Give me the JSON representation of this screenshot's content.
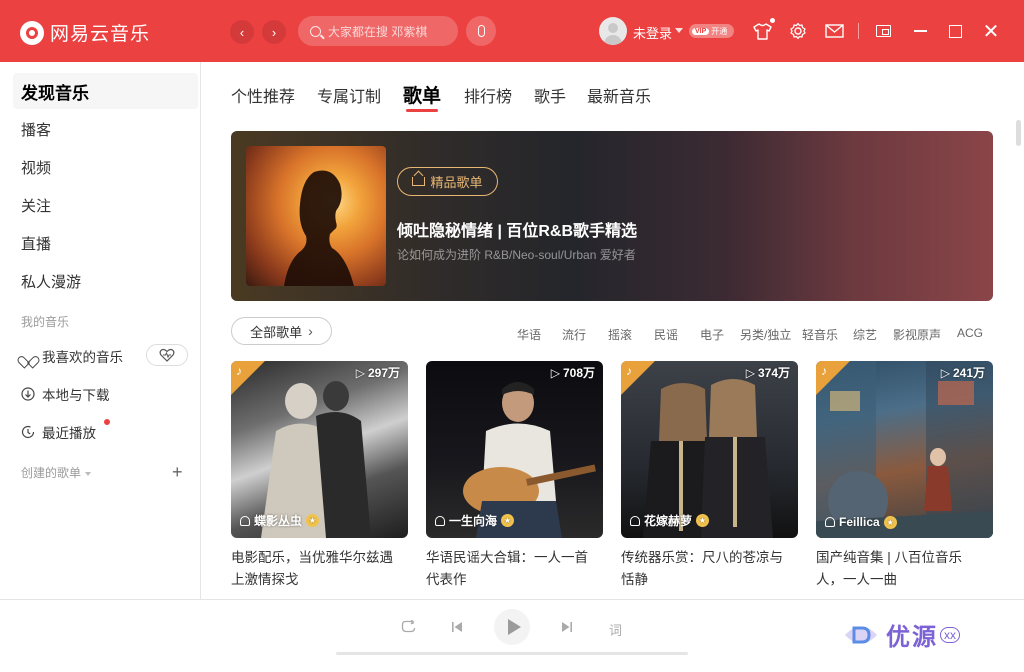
{
  "titlebar": {
    "app_name": "网易云音乐",
    "search_placeholder": "大家都在搜 邓紫棋",
    "login_label": "未登录",
    "vip_label": "开通",
    "vip_badge": "VIP",
    "accent_color": "#ec4141"
  },
  "sidebar": {
    "top_items": [
      {
        "label": "发现音乐",
        "active": true
      },
      {
        "label": "播客"
      },
      {
        "label": "视频"
      },
      {
        "label": "关注"
      },
      {
        "label": "直播"
      },
      {
        "label": "私人漫游"
      }
    ],
    "my_music_header": "我的音乐",
    "my_music_items": [
      {
        "label": "我喜欢的音乐",
        "icon": "heart-icon"
      },
      {
        "label": "本地与下载",
        "icon": "download-icon"
      },
      {
        "label": "最近播放",
        "icon": "clock-icon"
      }
    ],
    "created_header": "创建的歌单"
  },
  "tabs": [
    "个性推荐",
    "专属订制",
    "歌单",
    "排行榜",
    "歌手",
    "最新音乐"
  ],
  "active_tab": "歌单",
  "banner": {
    "badge": "精品歌单",
    "title": "倾吐隐秘情绪 | 百位R&B歌手精选",
    "subtitle": "论如何成为进阶 R&B/Neo-soul/Urban 爱好者"
  },
  "filter": {
    "all_label": "全部歌单",
    "genres": [
      "华语",
      "流行",
      "摇滚",
      "民谣",
      "电子",
      "另类/独立",
      "轻音乐",
      "综艺",
      "影视原声",
      "ACG"
    ]
  },
  "playlists": [
    {
      "plays": "297万",
      "creator": "蝶影丛虫",
      "title_line1": "电影配乐，当优雅华尔兹遇",
      "title_line2": "上激情探戈",
      "featured": true
    },
    {
      "plays": "708万",
      "creator": "一生向海",
      "title_line1": "华语民谣大合辑：一人一首",
      "title_line2": "代表作",
      "featured": false
    },
    {
      "plays": "374万",
      "creator": "花嫁赫萝",
      "title_line1": "传统器乐赏：尺八的苍凉与",
      "title_line2": "恬静",
      "featured": true
    },
    {
      "plays": "241万",
      "creator": "Feillica",
      "title_line1": "国产纯音集 | 八百位音乐",
      "title_line2": "人，一人一曲",
      "featured": true
    }
  ],
  "player": {
    "lyrics_label": "词"
  },
  "watermark": {
    "text": "优源",
    "small": "xx"
  }
}
